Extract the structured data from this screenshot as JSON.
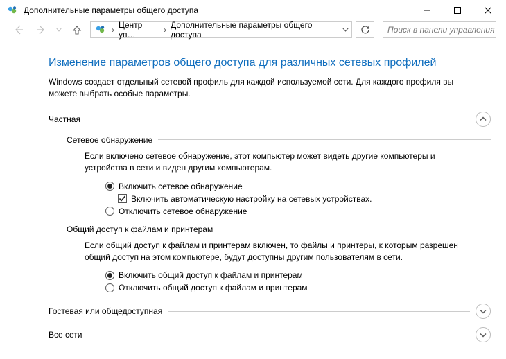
{
  "window": {
    "title": "Дополнительные параметры общего доступа"
  },
  "breadcrumb": {
    "item1": "Центр уп…",
    "item2": "Дополнительные параметры общего доступа"
  },
  "search": {
    "placeholder": "Поиск в панели управления"
  },
  "page": {
    "heading": "Изменение параметров общего доступа для различных сетевых профилей",
    "intro": "Windows создает отдельный сетевой профиль для каждой используемой сети. Для каждого профиля вы можете выбрать особые параметры."
  },
  "sections": {
    "private": {
      "label": "Частная",
      "networkDiscovery": {
        "label": "Сетевое обнаружение",
        "desc": "Если включено сетевое обнаружение, этот компьютер может видеть другие компьютеры и устройства в сети и виден другим компьютерам.",
        "optOn": "Включить сетевое обнаружение",
        "autoSetup": "Включить автоматическую настройку на сетевых устройствах.",
        "optOff": "Отключить сетевое обнаружение"
      },
      "fileSharing": {
        "label": "Общий доступ к файлам и принтерам",
        "desc": "Если общий доступ к файлам и принтерам включен, то файлы и принтеры, к которым разрешен общий доступ на этом компьютере, будут доступны другим пользователям в сети.",
        "optOn": "Включить общий доступ к файлам и принтерам",
        "optOff": "Отключить общий доступ к файлам и принтерам"
      }
    },
    "guest": {
      "label": "Гостевая или общедоступная"
    },
    "all": {
      "label": "Все сети"
    }
  }
}
